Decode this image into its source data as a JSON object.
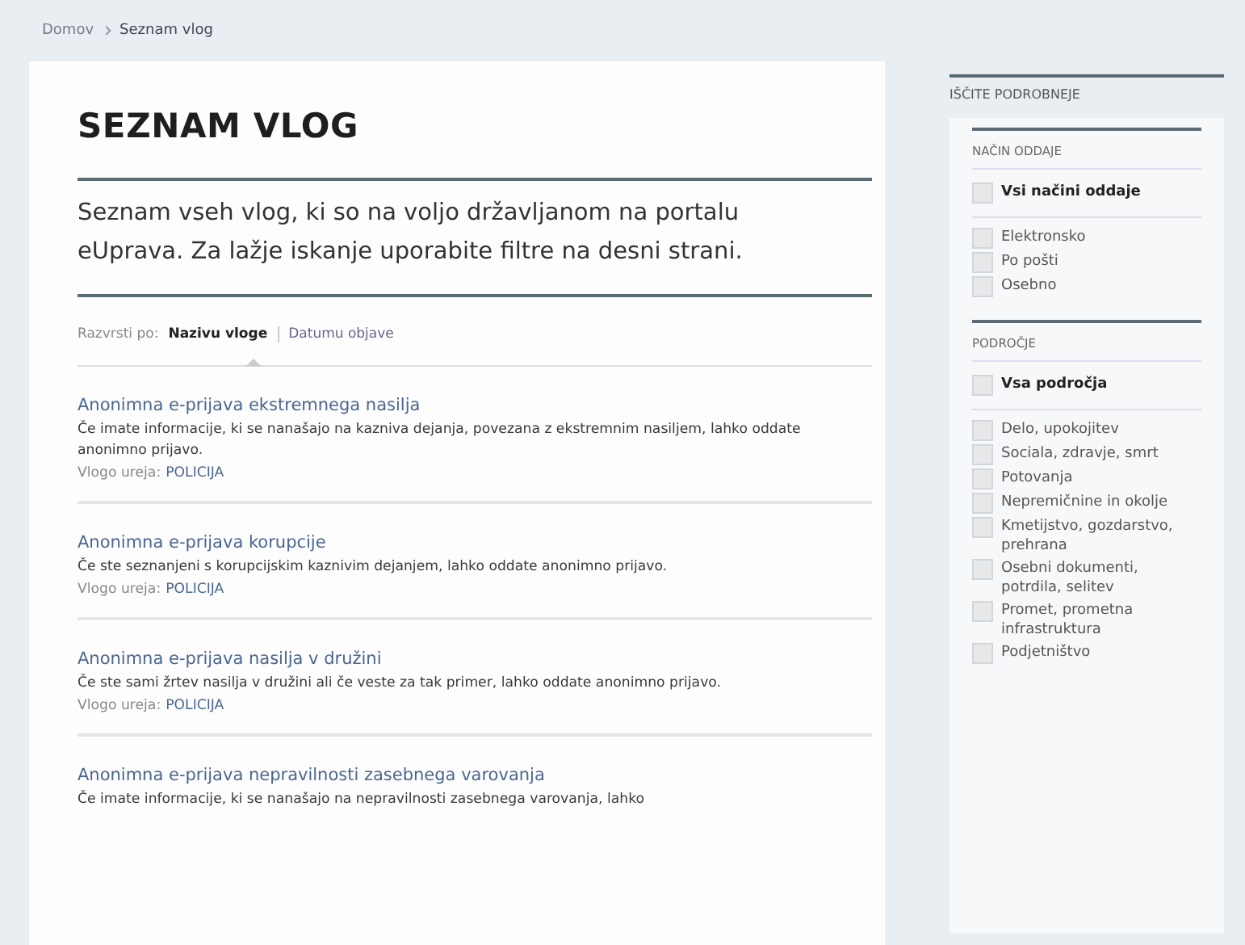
{
  "breadcrumb": [
    {
      "label": "Domov",
      "current": false
    },
    {
      "label": "Seznam vlog",
      "current": true
    }
  ],
  "page": {
    "title": "SEZNAM VLOG",
    "intro": "Seznam vseh vlog, ki so na voljo državljanom na portalu eUprava. Za lažje iskanje uporabite filtre na desni strani."
  },
  "sort": {
    "label": "Razvrsti po:",
    "options": [
      {
        "label": "Nazivu vloge",
        "selected": true
      },
      {
        "label": "Datumu objave",
        "selected": false
      }
    ]
  },
  "applications": [
    {
      "title": "Anonimna e-prijava ekstremnega nasilja",
      "description": "Če imate informacije, ki se nanašajo na kazniva dejanja, povezana z ekstremnim nasiljem, lahko oddate anonimno prijavo.",
      "owner_label": "Vlogo ureja:",
      "owner": "POLICIJA"
    },
    {
      "title": "Anonimna e-prijava korupcije",
      "description": "Če ste seznanjeni s korupcijskim kaznivim dejanjem, lahko oddate anonimno prijavo.",
      "owner_label": "Vlogo ureja:",
      "owner": "POLICIJA"
    },
    {
      "title": "Anonimna e-prijava nasilja v družini",
      "description": "Če ste sami žrtev nasilja v družini ali če veste za tak primer, lahko oddate anonimno prijavo.",
      "owner_label": "Vlogo ureja:",
      "owner": "POLICIJA"
    },
    {
      "title": "Anonimna e-prijava nepravilnosti zasebnega varovanja",
      "description": "Če imate informacije, ki se nanašajo na nepravilnosti zasebnega varovanja, lahko"
    }
  ],
  "filters": {
    "title": "IŠČITE PODROBNEJE",
    "groups": [
      {
        "title": "NAČIN ODDAJE",
        "all": {
          "label": "Vsi načini oddaje",
          "checked": false
        },
        "options": [
          {
            "label": "Elektronsko",
            "checked": false
          },
          {
            "label": "Po pošti",
            "checked": false
          },
          {
            "label": "Osebno",
            "checked": false
          }
        ]
      },
      {
        "title": "PODROČJE",
        "all": {
          "label": "Vsa področja",
          "checked": false
        },
        "options": [
          {
            "label": "Delo, upokojitev",
            "checked": false
          },
          {
            "label": "Sociala, zdravje, smrt",
            "checked": false
          },
          {
            "label": "Potovanja",
            "checked": false
          },
          {
            "label": "Nepremičnine in okolje",
            "checked": false
          },
          {
            "label": "Kmetijstvo, gozdarstvo, prehrana",
            "checked": false
          },
          {
            "label": "Osebni dokumenti, potrdila, selitev",
            "checked": false
          },
          {
            "label": "Promet, prometna infrastruktura",
            "checked": false
          },
          {
            "label": "Podjetništvo",
            "checked": false
          }
        ]
      }
    ]
  }
}
